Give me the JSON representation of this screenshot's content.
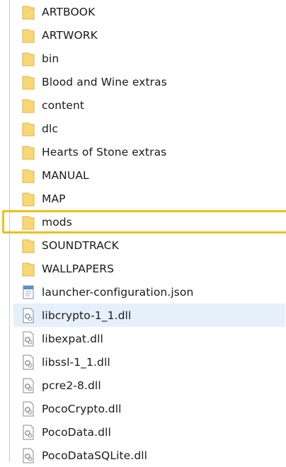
{
  "files": [
    {
      "name": "ARTBOOK",
      "type": "folder"
    },
    {
      "name": "ARTWORK",
      "type": "folder"
    },
    {
      "name": "bin",
      "type": "folder"
    },
    {
      "name": "Blood and Wine extras",
      "type": "folder"
    },
    {
      "name": "content",
      "type": "folder"
    },
    {
      "name": "dlc",
      "type": "folder"
    },
    {
      "name": "Hearts of Stone extras",
      "type": "folder"
    },
    {
      "name": "MANUAL",
      "type": "folder"
    },
    {
      "name": "MAP",
      "type": "folder"
    },
    {
      "name": "mods",
      "type": "folder"
    },
    {
      "name": "SOUNDTRACK",
      "type": "folder"
    },
    {
      "name": "WALLPAPERS",
      "type": "folder"
    },
    {
      "name": "launcher-configuration.json",
      "type": "json"
    },
    {
      "name": "libcrypto-1_1.dll",
      "type": "dll"
    },
    {
      "name": "libexpat.dll",
      "type": "dll"
    },
    {
      "name": "libssl-1_1.dll",
      "type": "dll"
    },
    {
      "name": "pcre2-8.dll",
      "type": "dll"
    },
    {
      "name": "PocoCrypto.dll",
      "type": "dll"
    },
    {
      "name": "PocoData.dll",
      "type": "dll"
    },
    {
      "name": "PocoDataSQLite.dll",
      "type": "dll"
    }
  ],
  "icons": {
    "folder": "folder-icon",
    "json": "json-file-icon",
    "dll": "dll-file-icon"
  },
  "colors": {
    "highlight_outline": "#f1bf18",
    "hover_background": "#e6f0fa",
    "folder_fill": "#f8d775"
  }
}
